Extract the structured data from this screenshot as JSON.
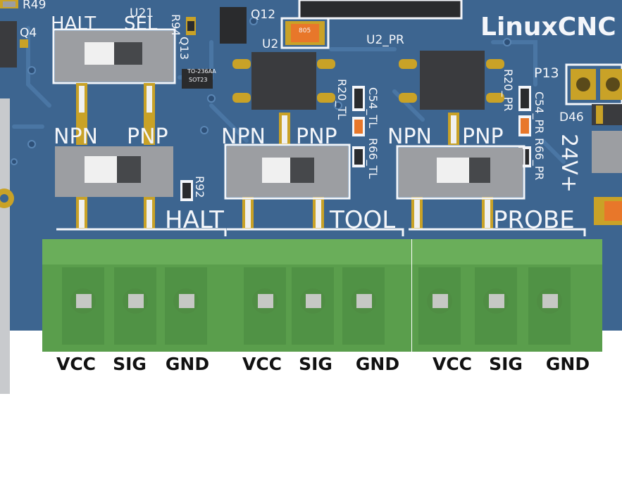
{
  "colors": {
    "board": "#3d6590",
    "board_dark": "#2e5078",
    "trace": "#4a76a4",
    "silkscreen": "#f4f6fa",
    "pad": "#c9a227",
    "switch_body": "#9c9ea2",
    "switch_slider": "#46484b",
    "terminal_green": "#5a9e4c",
    "terminal_dark": "#3f7a38",
    "chip": "#3a3b3e",
    "label_text": "#111111"
  },
  "board": {
    "logo_text": "LinuxCNC",
    "top_refs": {
      "r49": "R49",
      "q4": "Q4",
      "u21": "U21",
      "q12": "Q12",
      "r94": "R94",
      "q13": "Q13",
      "u2": "U2",
      "u2_pr": "U2_PR",
      "p13": "P13",
      "r20_pr": "R20_PR",
      "c54_pr": "C54_PR",
      "r66_pr": "R66_PR",
      "d46": "D46",
      "r20_tl": "R20_TL",
      "c54_tl": "C54_TL",
      "r66_tl": "R66_TL",
      "r92": "R92",
      "sot23": "SOT23",
      "to236aa": "TO-236AA",
      "cap_805": "805",
      "voltage": "24V+"
    },
    "top_switch": {
      "left_label": "HALT",
      "right_label": "SEL"
    },
    "switches": [
      {
        "left_label": "NPN",
        "right_label": "PNP",
        "section_label": "HALT"
      },
      {
        "left_label": "NPN",
        "right_label": "PNP",
        "section_label": "TOOL"
      },
      {
        "left_label": "NPN",
        "right_label": "PNP",
        "section_label": "PROBE"
      }
    ]
  },
  "connectors": [
    {
      "name": "HALT",
      "pins": [
        "VCC",
        "SIG",
        "GND"
      ]
    },
    {
      "name": "TOOL",
      "pins": [
        "VCC",
        "SIG",
        "GND"
      ]
    },
    {
      "name": "PROBE",
      "pins": [
        "VCC",
        "SIG",
        "GND"
      ]
    }
  ]
}
